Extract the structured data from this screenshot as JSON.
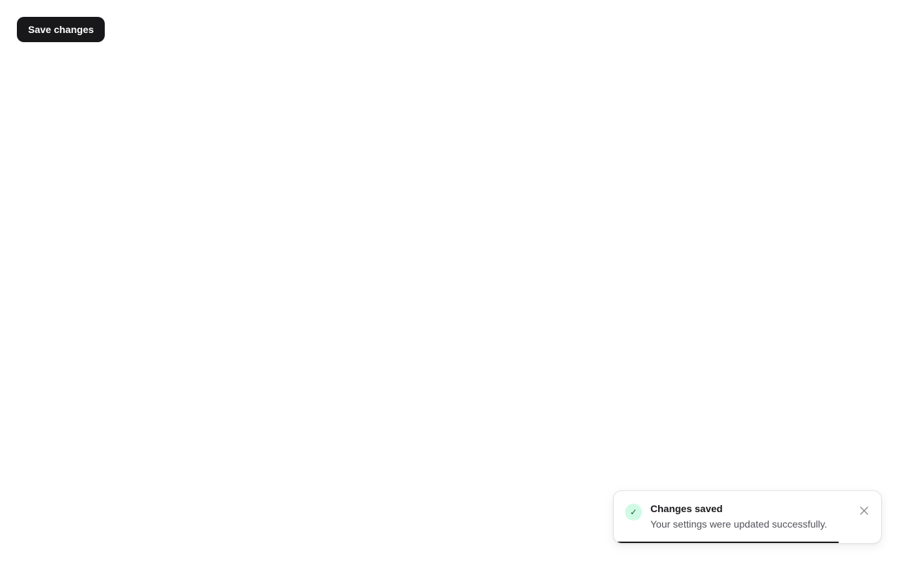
{
  "toolbar": {
    "save_label": "Save changes"
  },
  "toast": {
    "icon": "check-icon",
    "title": "Changes saved",
    "message": "Your settings were updated successfully.",
    "close_icon": "close-icon",
    "remaining_fraction": 0.85
  },
  "colors": {
    "button_bg": "#18181b",
    "button_text": "#ffffff",
    "success_bg": "#d1fae5",
    "success_icon": "#065f46",
    "progress": "#18181b"
  }
}
